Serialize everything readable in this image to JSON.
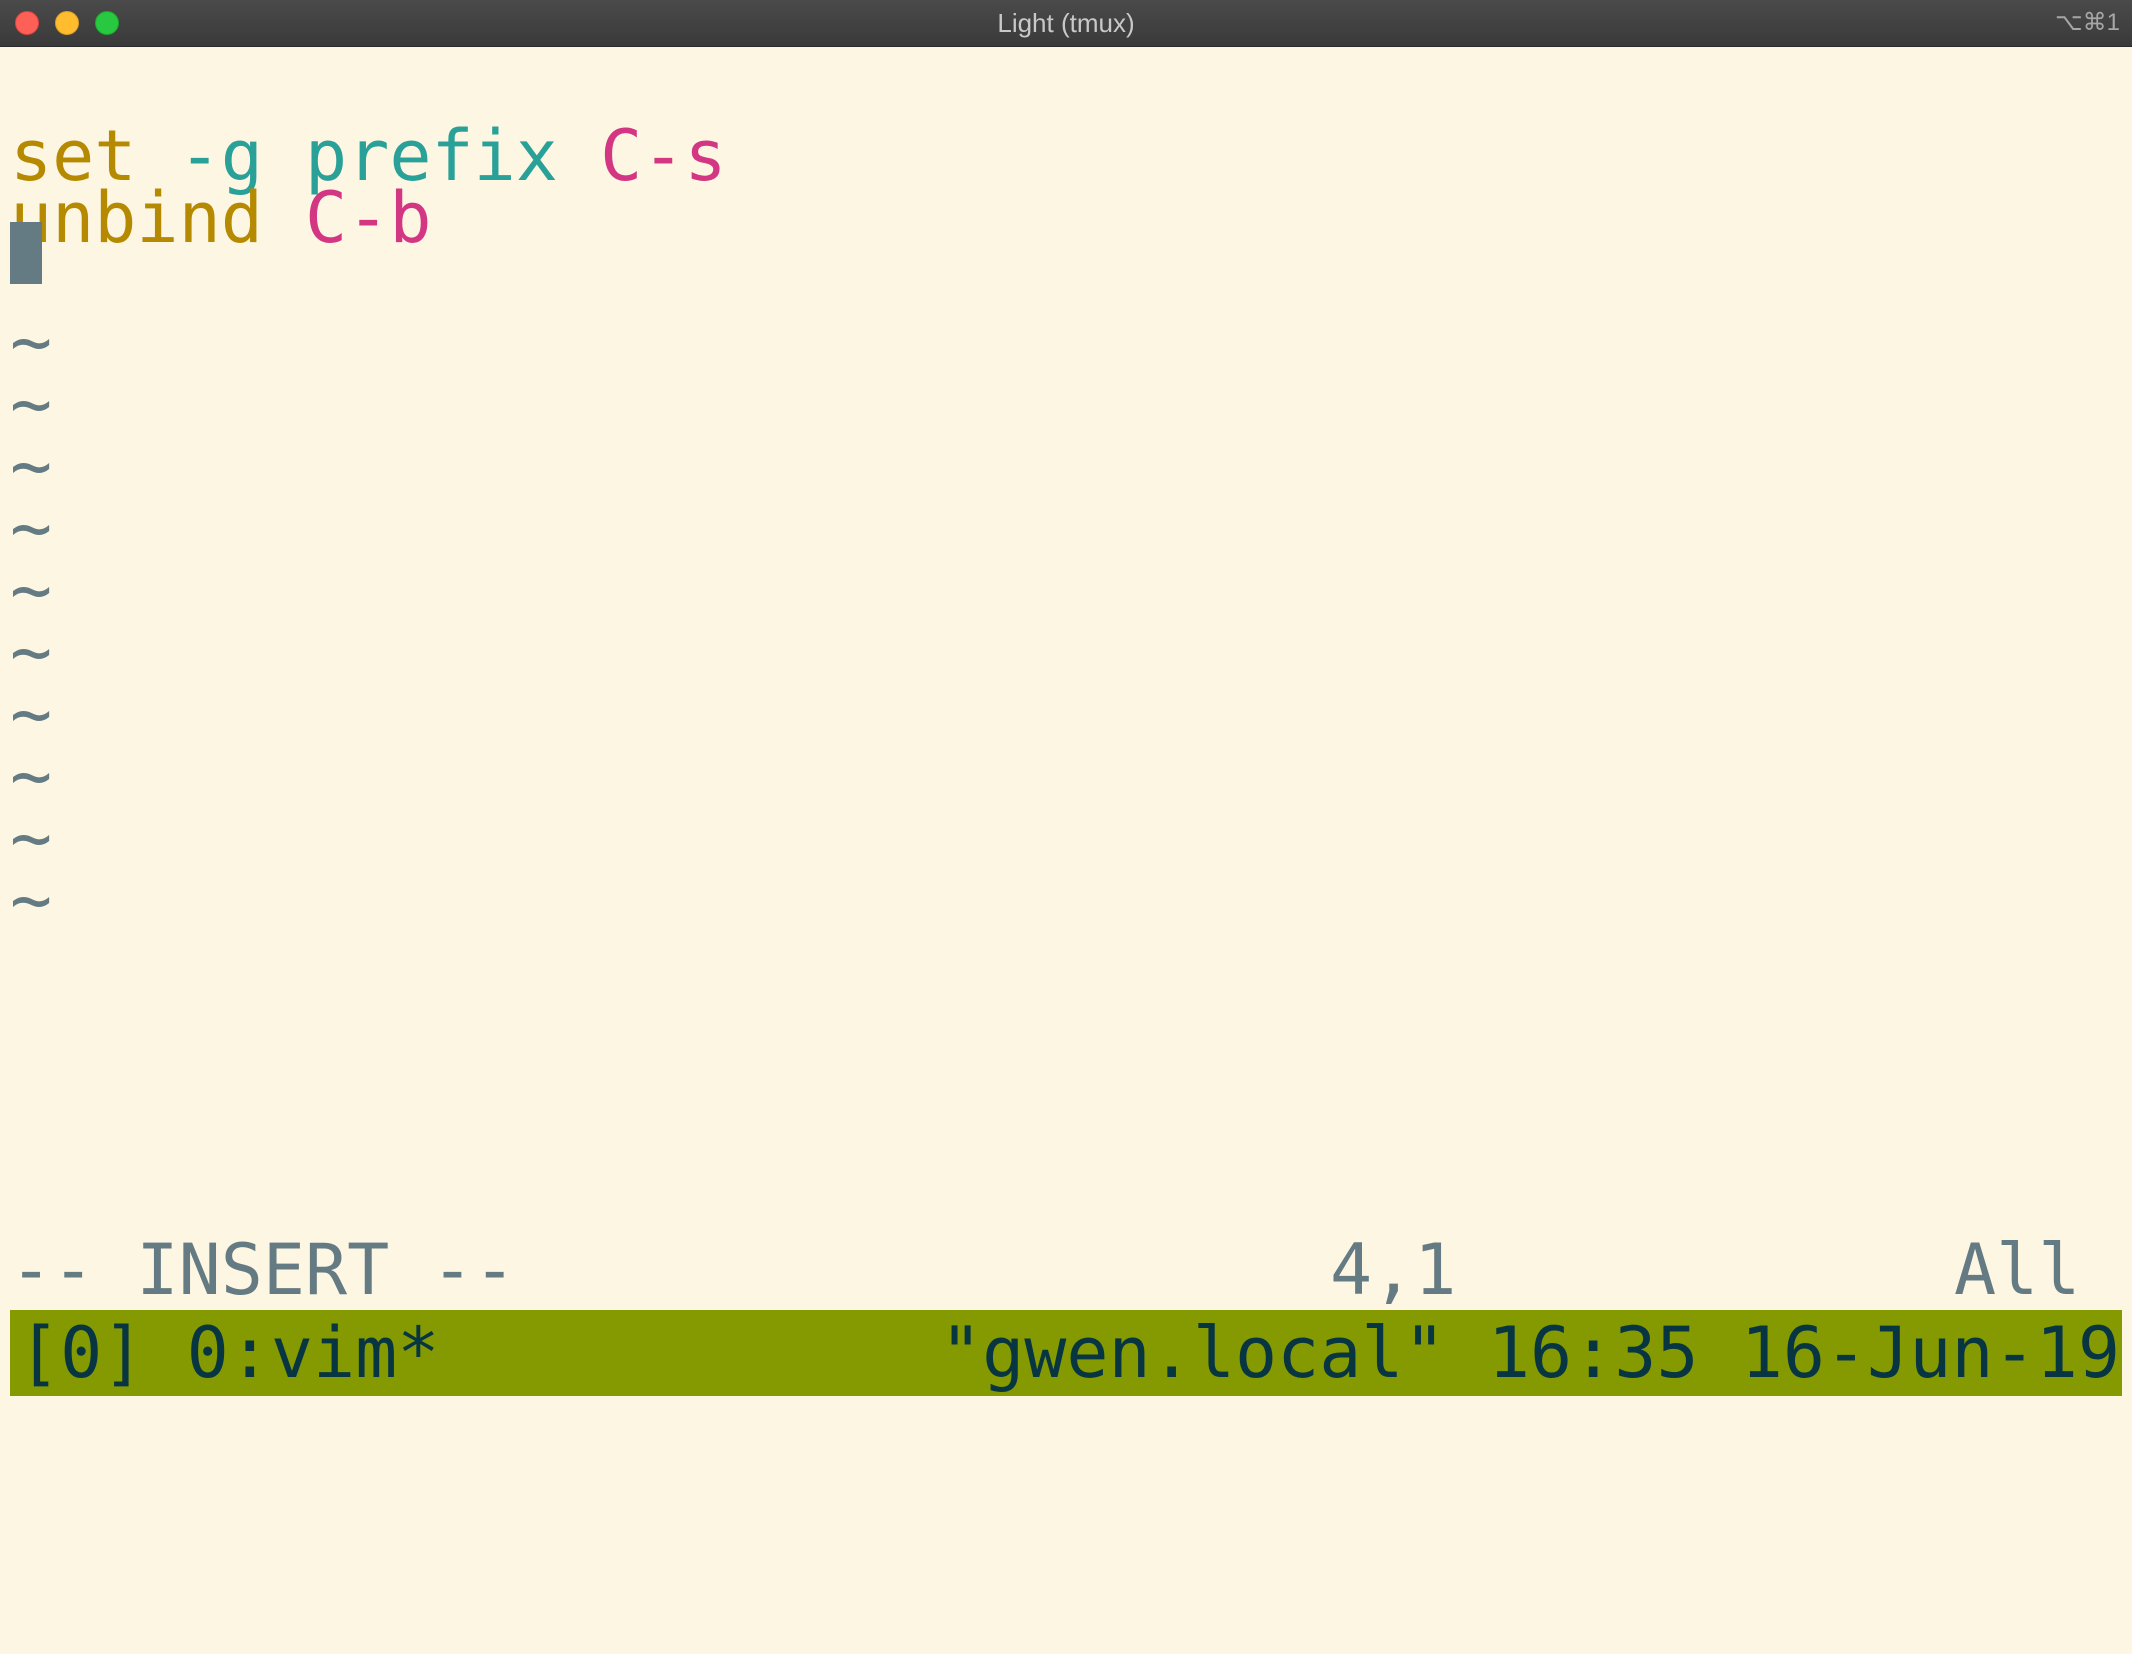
{
  "window": {
    "title": "Light (tmux)",
    "shortcut": "⌥⌘1"
  },
  "colors": {
    "background": "#fdf6e3",
    "keyword": "#b58900",
    "option": "#2aa198",
    "key": "#d33682",
    "comment": "#657b83",
    "statusbar_bg": "#859900",
    "statusbar_fg": "#073642"
  },
  "editor": {
    "lines": [
      {
        "parts": [
          {
            "text": "set",
            "kind": "keyword"
          },
          {
            "text": " ",
            "kind": "space"
          },
          {
            "text": "-g",
            "kind": "flag"
          },
          {
            "text": " ",
            "kind": "space"
          },
          {
            "text": "prefix",
            "kind": "option"
          },
          {
            "text": " ",
            "kind": "space"
          },
          {
            "text": "C-s",
            "kind": "key"
          }
        ]
      },
      {
        "parts": [
          {
            "text": "unbind",
            "kind": "keyword"
          },
          {
            "text": " ",
            "kind": "space"
          },
          {
            "text": "C-b",
            "kind": "key"
          }
        ]
      }
    ],
    "empty_line_marker": "~",
    "empty_line_count": 10
  },
  "vim_status": {
    "mode": "-- INSERT --",
    "position": "4,1",
    "scroll": "All"
  },
  "tmux_status": {
    "left": "[0] 0:vim*",
    "right": "\"gwen.local\" 16:35 16-Jun-19"
  }
}
